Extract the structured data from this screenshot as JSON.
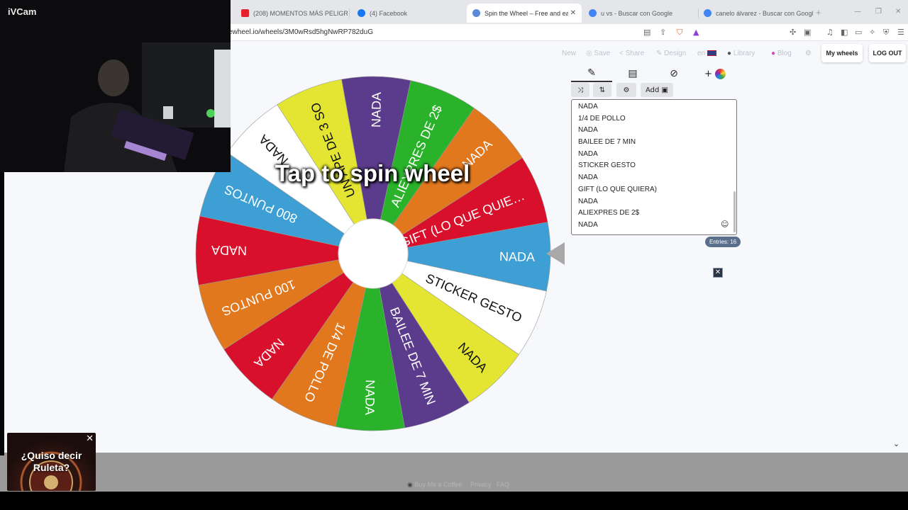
{
  "camera_overlay": {
    "label": "iVCam"
  },
  "tabs": [
    {
      "title": "(208) MOMENTOS MÁS PELIGROSOS",
      "favicon_color": "#e4232d"
    },
    {
      "title": "(4) Facebook",
      "favicon_color": "#1877f2"
    },
    {
      "title": "Spin the Wheel – Free and easy",
      "favicon_color": "#5b8ad8"
    },
    {
      "title": "u vs - Buscar con Google",
      "favicon_color": "#4285f4"
    },
    {
      "title": "canelo álvarez - Buscar con Google",
      "favicon_color": "#4285f4"
    }
  ],
  "address_bar": {
    "url": "ewheel.io/wheels/3M0wRsd5hgNwRP782duG"
  },
  "site_nav": {
    "links": [
      "New",
      "Save",
      "Share",
      "Design",
      "en",
      "Library",
      "Blog"
    ],
    "my_wheels": "My wheels",
    "logout": "LOG OUT"
  },
  "wheel": {
    "overlay_text": "Tap to spin wheel",
    "segments": [
      {
        "label": "NADA",
        "color": "#3d9fd3"
      },
      {
        "label": "STICKER GESTO",
        "color": "#ffffff"
      },
      {
        "label": "NADA",
        "color": "#e3e532"
      },
      {
        "label": "BAILEE DE 7 MIN",
        "color": "#5b3b8c"
      },
      {
        "label": "NADA",
        "color": "#2ab32a"
      },
      {
        "label": "1/4 DE POLLO",
        "color": "#e2781e"
      },
      {
        "label": "NADA",
        "color": "#d8102b"
      },
      {
        "label": "100 PUNTOS",
        "color": "#e2781e"
      },
      {
        "label": "NADA",
        "color": "#d8102b"
      },
      {
        "label": "800 PUNTOS",
        "color": "#3d9fd3"
      },
      {
        "label": "NADA",
        "color": "#ffffff"
      },
      {
        "label": "UN APE DE 3 SO",
        "color": "#e3e532"
      },
      {
        "label": "NADA",
        "color": "#5b3b8c"
      },
      {
        "label": "ALIEXPRES DE 2$",
        "color": "#2ab32a"
      },
      {
        "label": "NADA",
        "color": "#e2781e"
      },
      {
        "label": "GIFT (LO QUE QUIE…",
        "color": "#d8102b"
      }
    ]
  },
  "editor": {
    "add_label": "Add",
    "entries": [
      "NADA",
      "1/4 DE POLLO",
      "NADA",
      "BAILEE DE 7 MIN",
      "NADA",
      "STICKER GESTO",
      "NADA",
      "GIFT (LO QUE QUIERA)",
      "NADA",
      "ALIEXPRES DE 2$",
      "NADA"
    ],
    "entries_count": "Entries: 16"
  },
  "footer": {
    "links": [
      "Buy Me a Coffee",
      "Privacy",
      "FAQ"
    ]
  },
  "roulette_popup": {
    "line1": "¿Quiso decir",
    "line2": "Ruleta?"
  }
}
